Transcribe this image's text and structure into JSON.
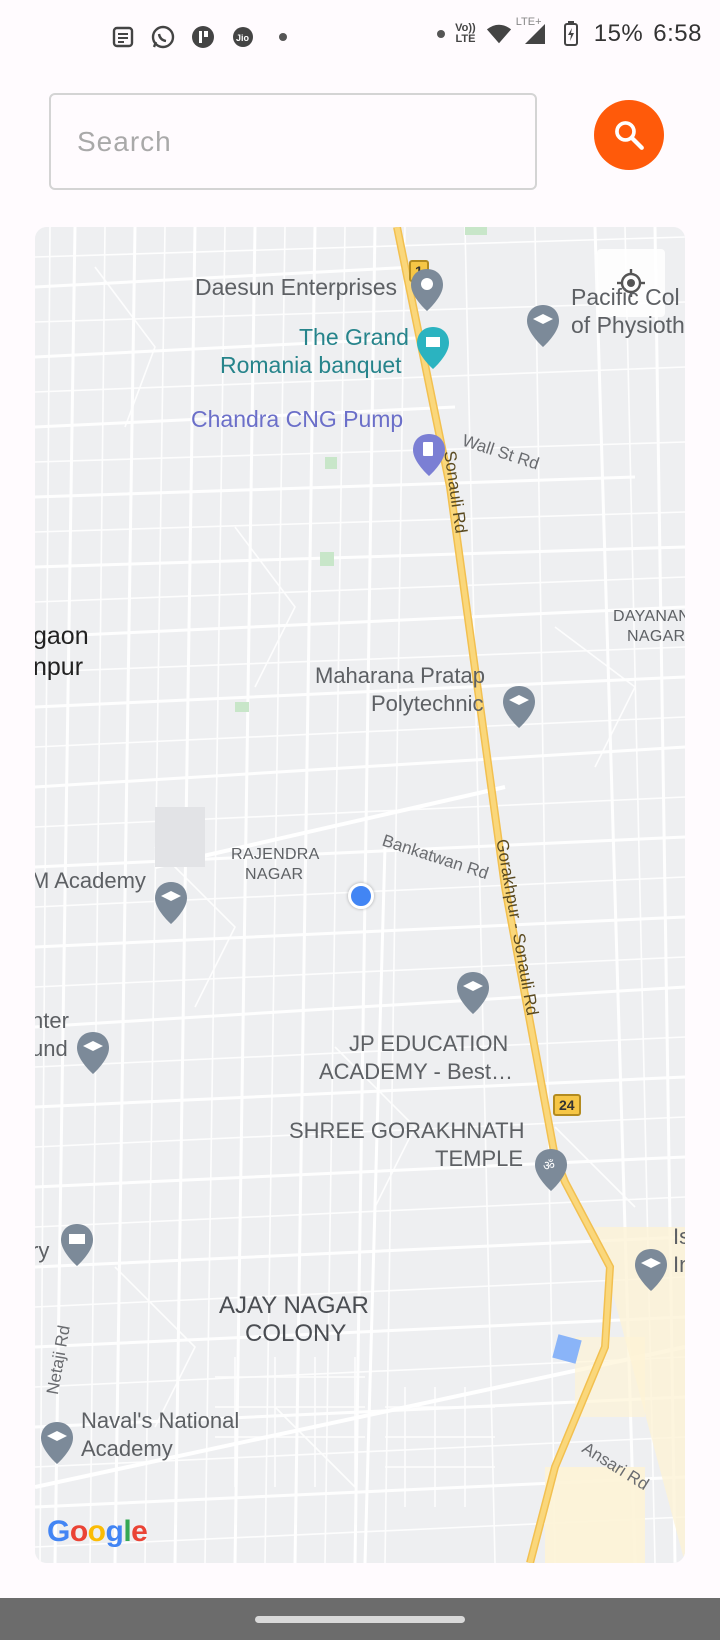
{
  "status_bar": {
    "battery": "15%",
    "time": "6:58",
    "network_label_top": "Vo)) ",
    "network_label_bottom": "LTE",
    "lte_plus": "LTE+",
    "icons": [
      "news-icon",
      "whatsapp-icon",
      "app-icon",
      "jio-icon",
      "notification-dot",
      "wifi-icon",
      "signal-icon",
      "battery-icon"
    ]
  },
  "search": {
    "placeholder": "Search",
    "button_icon": "search-icon",
    "button_color": "#ff5a0a"
  },
  "map": {
    "my_location_icon": "my-location-icon",
    "labels": {
      "daesun": "Daesun Enterprises",
      "grand_line1": "The Grand",
      "grand_line2": "Romania banquet",
      "chandra": "Chandra CNG Pump",
      "pacific_line1": "Pacific Col",
      "pacific_line2": "of Physioth",
      "wall_st": "Wall St Rd",
      "sonauli": "Sonauli Rd",
      "dayanand_line1": "DAYANAN",
      "dayanand_line2": "NAGAR",
      "gaon_line1": "gaon",
      "gaon_line2": "npur",
      "maharana_line1": "Maharana Pratap",
      "maharana_line2": "Polytechnic",
      "rajendra_line1": "RAJENDRA",
      "rajendra_line2": "NAGAR",
      "bankatwan": "Bankatwan Rd",
      "academy": "M Academy",
      "gorakhpur_sonauli": "Gorakhpur - Sonauli Rd",
      "center_line1": "nter",
      "center_line2": "und",
      "jp_line1": "JP EDUCATION",
      "jp_line2": "ACADEMY - Best…",
      "shree_line1": "SHREE GORAKHNATH",
      "shree_line2": "TEMPLE",
      "ry": "ry",
      "is_line1": "Is",
      "is_line2": "In",
      "ajay_line1": "AJAY NAGAR",
      "ajay_line2": "COLONY",
      "netaji": "Netaji Rd",
      "navals_line1": "Naval's National",
      "navals_line2": "Academy",
      "ansari": "Ansari Rd",
      "shield_1": "1",
      "shield_24": "24"
    },
    "attribution": "Google"
  }
}
